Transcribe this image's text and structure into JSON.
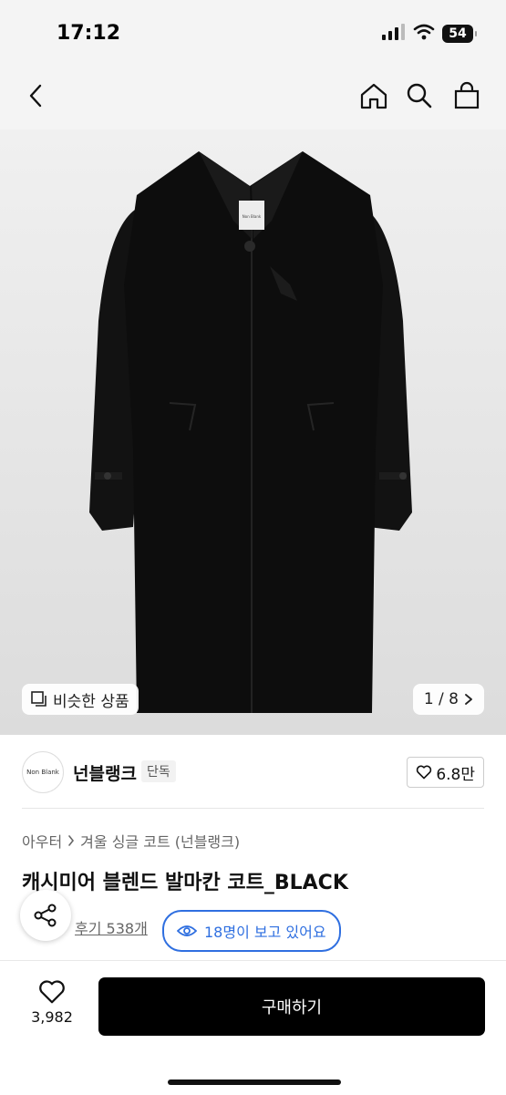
{
  "status": {
    "time": "17:12",
    "battery": "54"
  },
  "nav": {
    "back_icon": "chevron-left-icon",
    "icons": [
      "home-icon",
      "search-icon",
      "shopping-bag-icon"
    ]
  },
  "gallery": {
    "similar_label": "비슷한 상품",
    "counter": "1 / 8",
    "garment_label": "Non Blank",
    "current": 1,
    "total": 8
  },
  "brand": {
    "logo_text": "Non Blank",
    "name": "넌블랭크",
    "tag": "단독",
    "likes": "6.8만"
  },
  "product": {
    "breadcrumb": [
      "아우터",
      "겨울 싱글 코트 (넌블랭크)"
    ],
    "title": "캐시미어 블렌드 발마칸 코트_BLACK",
    "reviews": "후기 538개",
    "viewers": "18명이 보고 있어요"
  },
  "bottom": {
    "wish_count": "3,982",
    "buy_label": "구매하기"
  },
  "colors": {
    "accent_blue": "#2f6fe0",
    "buy_button": "#000000",
    "hero_bg": "#e4e4e4"
  }
}
